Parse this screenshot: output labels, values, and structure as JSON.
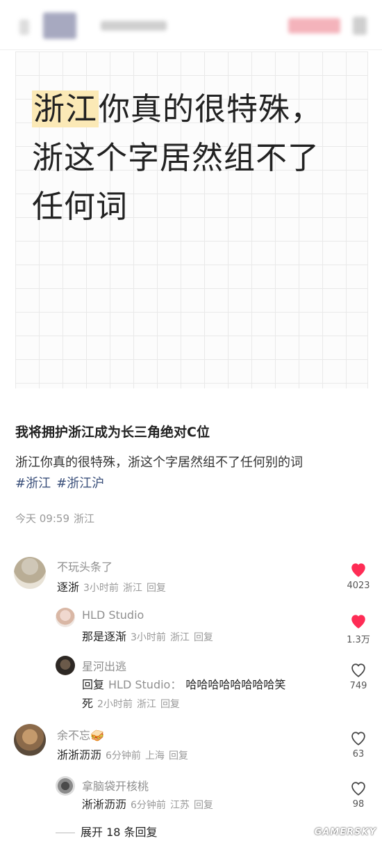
{
  "post": {
    "headline": {
      "highlight": "浙江",
      "line1_rest": "你真的很特殊，",
      "line2": "浙这个字居然组不了",
      "line3": "任何词"
    },
    "title": "我将拥护浙江成为长三角绝对C位",
    "body": "浙江你真的很特殊，浙这个字居然组不了任何别的词",
    "tags": [
      "#浙江",
      "#浙江沪"
    ],
    "meta": {
      "time": "今天 09:59",
      "location": "浙江"
    }
  },
  "comments": [
    {
      "user": "不玩头条了",
      "text": "逐浙",
      "time": "3小时前",
      "location": "浙江",
      "reply_label": "回复",
      "likes": "4023",
      "liked": true
    },
    {
      "user": "HLD Studio",
      "text": "那是逐渐",
      "time": "3小时前",
      "location": "浙江",
      "reply_label": "回复",
      "likes": "1.3万",
      "liked": true
    },
    {
      "user": "星河出逃",
      "reply_prefix": "回复",
      "reply_to": "HLD Studio：",
      "text_line1": "哈哈哈哈哈哈哈哈笑",
      "text_line2": "死",
      "time": "2小时前",
      "location": "浙江",
      "reply_label": "回复",
      "likes": "749",
      "liked": false
    },
    {
      "user": "余不忘",
      "user_emoji": "🥪",
      "text": "浙浙沥沥",
      "time": "6分钟前",
      "location": "上海",
      "reply_label": "回复",
      "likes": "63",
      "liked": false
    },
    {
      "user": "拿脑袋开核桃",
      "text": "淅淅沥沥",
      "time": "6分钟前",
      "location": "江苏",
      "reply_label": "回复",
      "likes": "98",
      "liked": false
    }
  ],
  "expand_label": "展开 18 条回复",
  "watermark": "GAMERSKY",
  "colors": {
    "like_red": "#fe2c55",
    "tag_blue": "#3a4f7a",
    "highlight": "#fbe9b6"
  }
}
